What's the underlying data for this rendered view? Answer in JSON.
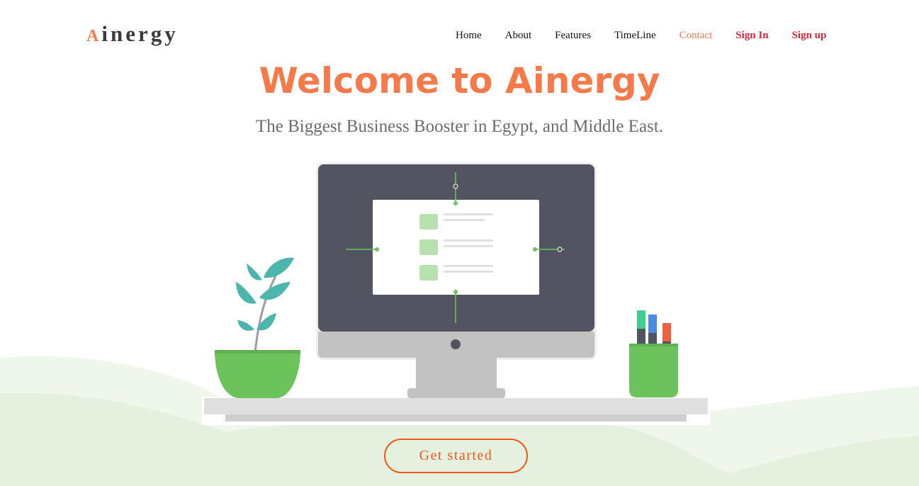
{
  "logo": {
    "first_letter": "A",
    "rest": "inergy"
  },
  "nav": {
    "home": "Home",
    "about": "About",
    "features": "Features",
    "timeline": "TimeLine",
    "contact": "Contact",
    "sign_in": "Sign In",
    "sign_up": "Sign up"
  },
  "hero": {
    "title": "Welcome to Ainergy",
    "subtitle": "The Biggest Business Booster in Egypt, and Middle East.",
    "cta_label": "Get started"
  },
  "colors": {
    "accent": "#f47a4a",
    "auth": "#d7263d",
    "green": "#6cc35b",
    "monitor": "#525461",
    "hills_light": "#eef7ea",
    "hills_dark": "#e3f1de"
  },
  "illustration": {
    "icons": [
      "plant-icon",
      "monitor-icon",
      "pen-cup-icon",
      "desk-icon"
    ]
  }
}
